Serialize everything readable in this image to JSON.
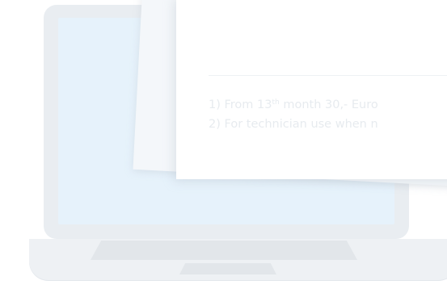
{
  "footnotes": {
    "note1": {
      "number": "1)",
      "before": "From 13",
      "sup": "th",
      "after": " month 30,- Euro"
    },
    "note2": {
      "number": "2)",
      "text": "For technician use when n"
    }
  }
}
